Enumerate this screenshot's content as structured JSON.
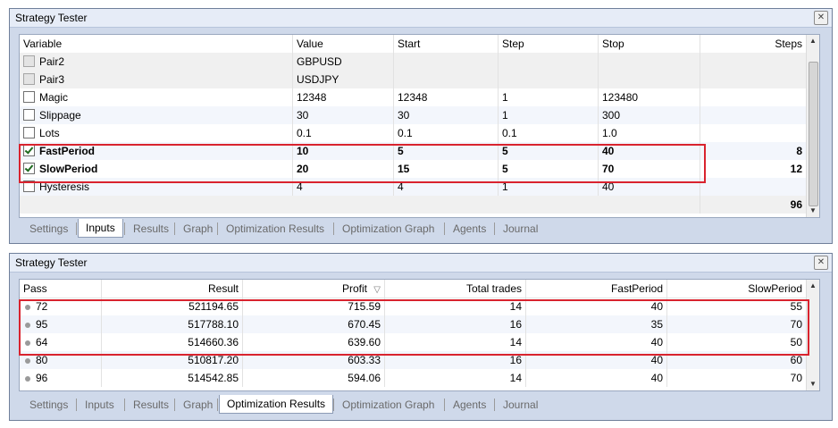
{
  "panel1": {
    "title": "Strategy Tester",
    "columns": [
      "Variable",
      "Value",
      "Start",
      "Step",
      "Stop",
      "Steps"
    ],
    "rows": [
      {
        "name": "Pair2",
        "value": "GBPUSD",
        "start": "",
        "step": "",
        "stop": "",
        "steps": "",
        "checkbox": "disabled",
        "bold": false
      },
      {
        "name": "Pair3",
        "value": "USDJPY",
        "start": "",
        "step": "",
        "stop": "",
        "steps": "",
        "checkbox": "disabled",
        "bold": false
      },
      {
        "name": "Magic",
        "value": "12348",
        "start": "12348",
        "step": "1",
        "stop": "123480",
        "steps": "",
        "checkbox": "unchecked",
        "bold": false
      },
      {
        "name": "Slippage",
        "value": "30",
        "start": "30",
        "step": "1",
        "stop": "300",
        "steps": "",
        "checkbox": "unchecked",
        "bold": false
      },
      {
        "name": "Lots",
        "value": "0.1",
        "start": "0.1",
        "step": "0.1",
        "stop": "1.0",
        "steps": "",
        "checkbox": "unchecked",
        "bold": false
      },
      {
        "name": "FastPeriod",
        "value": "10",
        "start": "5",
        "step": "5",
        "stop": "40",
        "steps": "8",
        "checkbox": "checked",
        "bold": true
      },
      {
        "name": "SlowPeriod",
        "value": "20",
        "start": "15",
        "step": "5",
        "stop": "70",
        "steps": "12",
        "checkbox": "checked",
        "bold": true
      },
      {
        "name": "Hysteresis",
        "value": "4",
        "start": "4",
        "step": "1",
        "stop": "40",
        "steps": "",
        "checkbox": "unchecked",
        "bold": false
      }
    ],
    "total_steps": "96",
    "tabs": [
      "Settings",
      "Inputs",
      "Results",
      "Graph",
      "Optimization Results",
      "Optimization Graph",
      "Agents",
      "Journal"
    ],
    "active_tab": "Inputs"
  },
  "panel2": {
    "title": "Strategy Tester",
    "columns": [
      "Pass",
      "Result",
      "Profit",
      "Total trades",
      "FastPeriod",
      "SlowPeriod"
    ],
    "sort_indicator": "▽",
    "rows": [
      [
        "72",
        "521194.65",
        "715.59",
        "14",
        "40",
        "55"
      ],
      [
        "95",
        "517788.10",
        "670.45",
        "16",
        "35",
        "70"
      ],
      [
        "64",
        "514660.36",
        "639.60",
        "14",
        "40",
        "50"
      ],
      [
        "80",
        "510817.20",
        "603.33",
        "16",
        "40",
        "60"
      ],
      [
        "96",
        "514542.85",
        "594.06",
        "14",
        "40",
        "70"
      ]
    ],
    "tabs": [
      "Settings",
      "Inputs",
      "Results",
      "Graph",
      "Optimization Results",
      "Optimization Graph",
      "Agents",
      "Journal"
    ],
    "active_tab": "Optimization Results"
  },
  "colors": {
    "highlight": "#d9232e",
    "frame": "#cfd9ea"
  },
  "icons": {
    "close": "close-icon",
    "checked": "checkbox-checked-icon",
    "unchecked": "checkbox-unchecked-icon",
    "pass": "pass-dot-icon"
  }
}
